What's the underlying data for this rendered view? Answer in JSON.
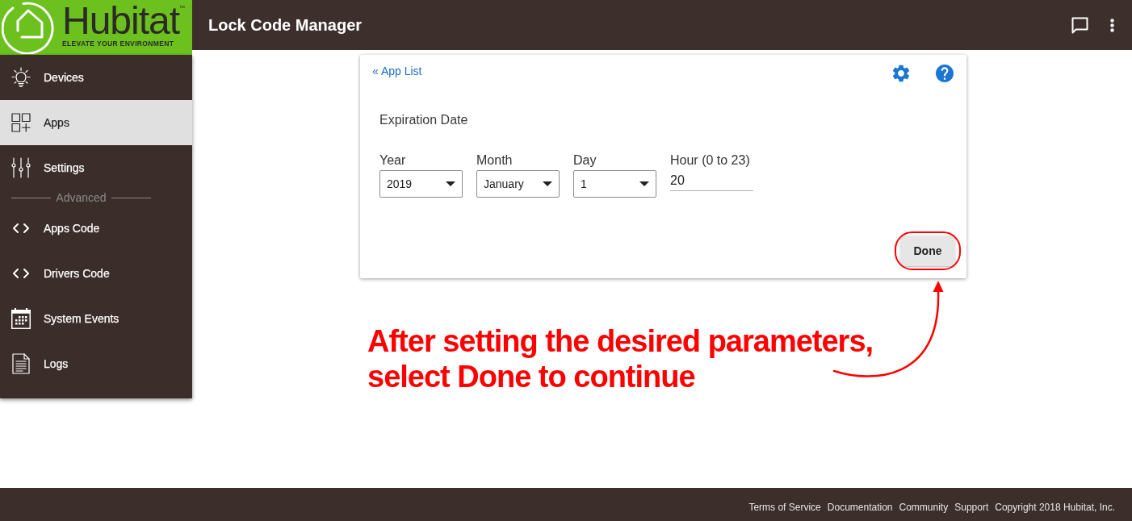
{
  "header": {
    "logo": {
      "wordmark": "Hubitat",
      "trademark": "™",
      "tagline": "ELEVATE YOUR ENVIRONMENT"
    },
    "title": "Lock Code Manager"
  },
  "sidebar": {
    "items": [
      {
        "label": "Devices",
        "selected": false
      },
      {
        "label": "Apps",
        "selected": true
      },
      {
        "label": "Settings",
        "selected": false
      }
    ],
    "section": {
      "label": "Advanced",
      "items": [
        {
          "label": "Apps Code",
          "selected": false
        },
        {
          "label": "Drivers Code",
          "selected": false
        },
        {
          "label": "System Events",
          "selected": false
        },
        {
          "label": "Logs",
          "selected": false
        }
      ]
    }
  },
  "card": {
    "back_link": "« App List",
    "section_title": "Expiration Date",
    "fields": [
      {
        "kind": "select",
        "label": "Year",
        "value": "2019"
      },
      {
        "kind": "select",
        "label": "Month",
        "value": "January"
      },
      {
        "kind": "select",
        "label": "Day",
        "value": "1"
      },
      {
        "kind": "text",
        "label": "Hour (0 to 23)",
        "value": "20"
      }
    ],
    "done_button": {
      "label": "Done",
      "circled": true
    }
  },
  "annotation": {
    "text": "After setting the desired parameters,\nselect Done to continue"
  },
  "footer": {
    "links": [
      "Terms of Service",
      "Documentation",
      "Community",
      "Support"
    ],
    "copyright": "Copyright 2018 Hubitat, Inc."
  }
}
